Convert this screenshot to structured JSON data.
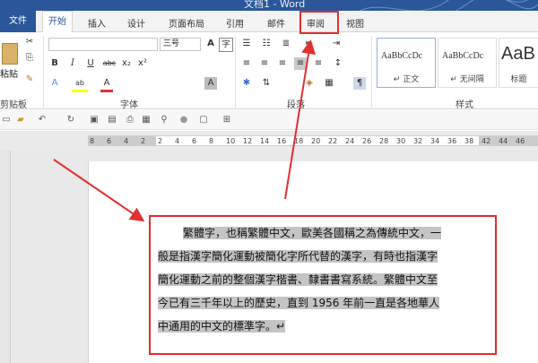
{
  "window": {
    "title": "文档1 - Word"
  },
  "tabs": {
    "file": "文件",
    "home": "开始",
    "insert": "插入",
    "design": "设计",
    "layout": "页面布局",
    "references": "引用",
    "mailings": "邮件",
    "review": "审阅",
    "view": "视图"
  },
  "ribbon": {
    "clipboard": {
      "label": "剪贴板",
      "paste": "粘贴"
    },
    "font": {
      "label": "字体",
      "font_name": "",
      "font_size": "三号",
      "bold": "B",
      "italic": "I",
      "underline": "U",
      "strike": "abc",
      "subscript": "x₂",
      "superscript": "x²",
      "text_effects": "A",
      "highlight": "ab",
      "font_color": "A",
      "char_shading": "A",
      "enclose": "字"
    },
    "paragraph": {
      "label": "段落"
    },
    "styles": {
      "label": "样式",
      "items": [
        {
          "sample": "AaBbCcDc",
          "name": "↵ 正文"
        },
        {
          "sample": "AaBbCcDc",
          "name": "↵ 无间隔"
        },
        {
          "sample": "AaB",
          "name": "标题"
        }
      ]
    }
  },
  "ruler": {
    "ticks": [
      "8",
      "6",
      "4",
      "2",
      "2",
      "4",
      "6",
      "8",
      "10",
      "12",
      "14",
      "16",
      "18",
      "20",
      "22",
      "24",
      "26",
      "28",
      "30",
      "32",
      "34",
      "36",
      "38",
      "42",
      "44",
      "46"
    ]
  },
  "document": {
    "lines": [
      "繁體字，也稱繁體中文，歐美各國稱之為傳統中文，一",
      "般是指漢字簡化運動被簡化字所代替的漢字，有時也指漢字",
      "簡化運動之前的整個漢字楷書、隸書書寫系統。繁體中文至",
      "今已有三千年以上的歷史，直到 1956 年前一直是各地華人",
      "中通用的中文的標準字。↵"
    ]
  },
  "colors": {
    "accent": "#2b579a",
    "annotation": "#e03030",
    "selection": "#c4c4c4"
  }
}
